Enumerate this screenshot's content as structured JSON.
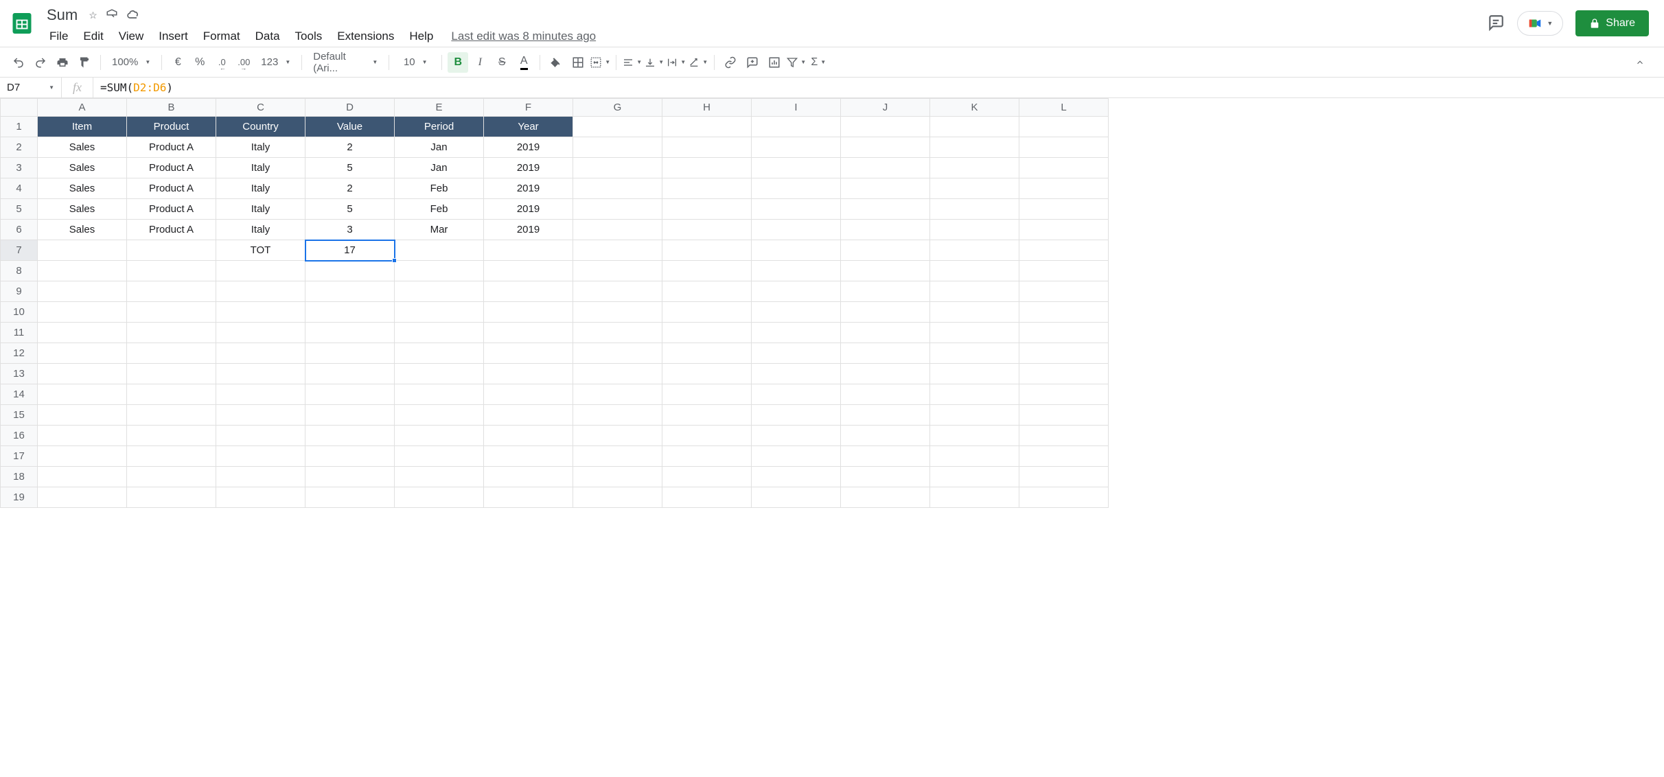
{
  "doc": {
    "title": "Sum",
    "last_edit": "Last edit was 8 minutes ago"
  },
  "menus": [
    "File",
    "Edit",
    "View",
    "Insert",
    "Format",
    "Data",
    "Tools",
    "Extensions",
    "Help"
  ],
  "share_label": "Share",
  "toolbar": {
    "zoom": "100%",
    "currency": "€",
    "percent": "%",
    "dec_less": ".0",
    "dec_more": ".00",
    "num_fmt": "123",
    "font": "Default (Ari...",
    "font_size": "10"
  },
  "name_box": "D7",
  "formula": {
    "prefix": "=SUM(",
    "range": "D2:D6",
    "suffix": ")"
  },
  "columns": [
    "A",
    "B",
    "C",
    "D",
    "E",
    "F",
    "G",
    "H",
    "I",
    "J",
    "K",
    "L"
  ],
  "row_numbers": [
    "1",
    "2",
    "3",
    "4",
    "5",
    "6",
    "7",
    "8",
    "9",
    "10",
    "11",
    "12",
    "13",
    "14",
    "15",
    "16",
    "17",
    "18",
    "19"
  ],
  "headers": [
    "Item",
    "Product",
    "Country",
    "Value",
    "Period",
    "Year"
  ],
  "rows": [
    [
      "Sales",
      "Product A",
      "Italy",
      "2",
      "Jan",
      "2019"
    ],
    [
      "Sales",
      "Product A",
      "Italy",
      "5",
      "Jan",
      "2019"
    ],
    [
      "Sales",
      "Product A",
      "Italy",
      "2",
      "Feb",
      "2019"
    ],
    [
      "Sales",
      "Product A",
      "Italy",
      "5",
      "Feb",
      "2019"
    ],
    [
      "Sales",
      "Product A",
      "Italy",
      "3",
      "Mar",
      "2019"
    ]
  ],
  "total": {
    "label": "TOT",
    "value": "17"
  },
  "selected_cell": "D7"
}
